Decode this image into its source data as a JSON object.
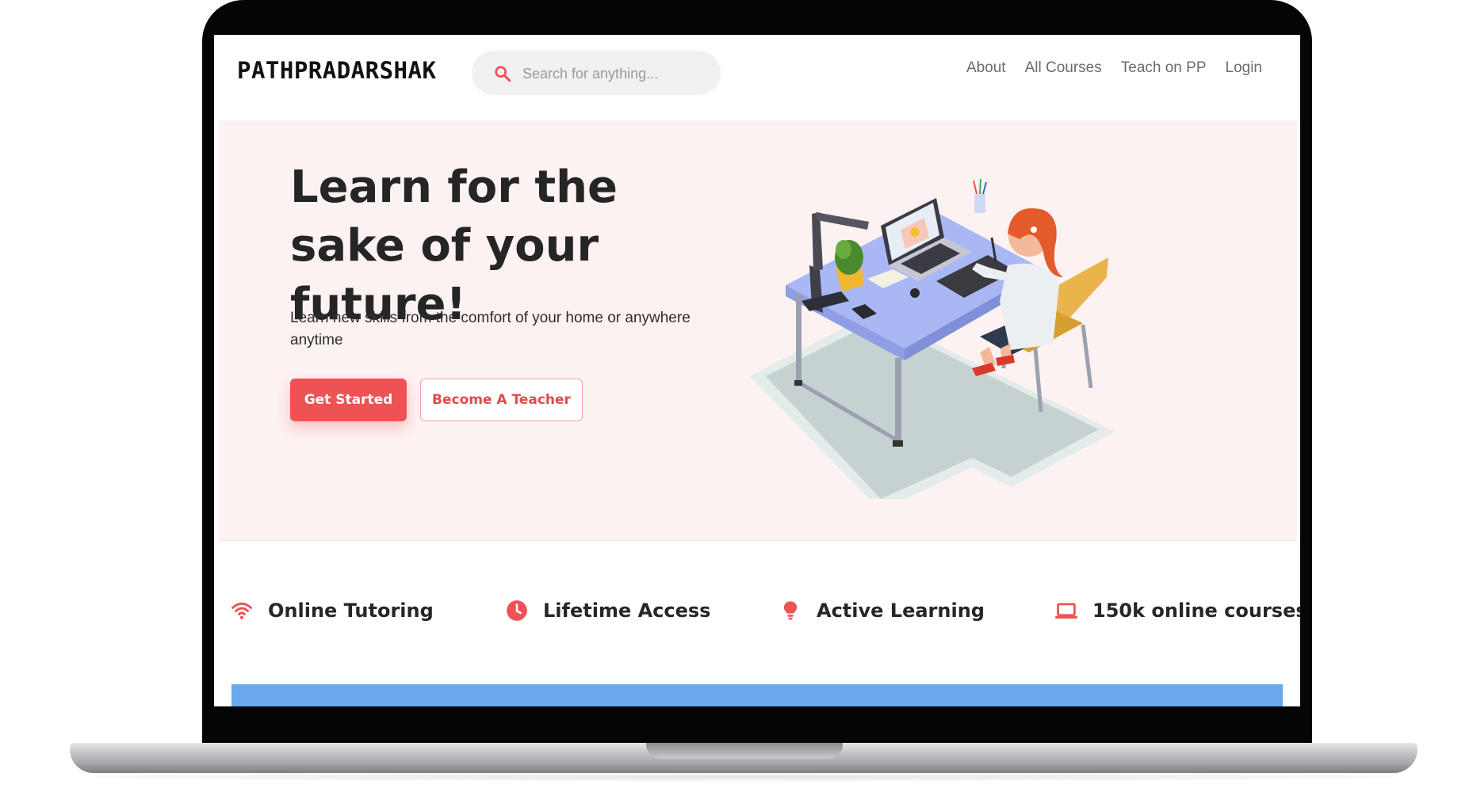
{
  "colors": {
    "accent": "#ee5254",
    "hero_bg": "#fdf2f2",
    "band": "#6aa8ee"
  },
  "nav": {
    "brand": "PATHPRADARSHAK",
    "search_placeholder": "Search for anything...",
    "search_icon": "search-icon",
    "links": [
      "About",
      "All Courses",
      "Teach on PP",
      "Login"
    ]
  },
  "hero": {
    "title": "Learn for the sake of your future!",
    "subtitle": "Learn new skills from the comfort of your home or anywhere anytime",
    "primary_button": "Get Started",
    "secondary_button": "Become A Teacher",
    "illustration": "woman-at-desk-illustration"
  },
  "features": [
    {
      "icon": "wifi-icon",
      "label": "Online Tutoring"
    },
    {
      "icon": "clock-icon",
      "label": "Lifetime Access"
    },
    {
      "icon": "lightbulb-icon",
      "label": "Active Learning"
    },
    {
      "icon": "laptop-icon",
      "label": "150k online courses"
    }
  ]
}
